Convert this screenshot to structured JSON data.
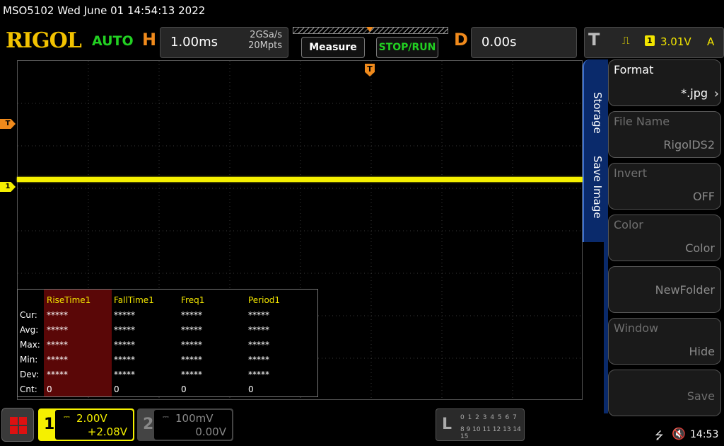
{
  "status_line": "MSO5102  Wed June 01 14:54:13 2022",
  "brand": "RIGOL",
  "trigger_mode": "AUTO",
  "horizontal": {
    "letter": "H",
    "timebase": "1.00ms",
    "sample_rate": "2GSa/s",
    "memory_depth": "20Mpts"
  },
  "toolbar": {
    "measure_label": "Measure",
    "stoprun_label": "STOP/RUN"
  },
  "delay": {
    "letter": "D",
    "value": "0.00s"
  },
  "trigger": {
    "letter": "T",
    "source": "1",
    "level": "3.01V",
    "coupling": "A",
    "edge_icon": "rising-edge-icon"
  },
  "markers": {
    "trigger_level": "T",
    "ch1_offset": "1",
    "trigger_position": "T"
  },
  "measurements": {
    "headers": [
      "RiseTime1",
      "FallTime1",
      "Freq1",
      "Period1"
    ],
    "rows": [
      {
        "label": "Cur:",
        "values": [
          "*****",
          "*****",
          "*****",
          "*****"
        ]
      },
      {
        "label": "Avg:",
        "values": [
          "*****",
          "*****",
          "*****",
          "*****"
        ]
      },
      {
        "label": "Max:",
        "values": [
          "*****",
          "*****",
          "*****",
          "*****"
        ]
      },
      {
        "label": "Min:",
        "values": [
          "*****",
          "*****",
          "*****",
          "*****"
        ]
      },
      {
        "label": "Dev:",
        "values": [
          "*****",
          "*****",
          "*****",
          "*****"
        ]
      },
      {
        "label": "Cnt:",
        "values": [
          "0",
          "0",
          "0",
          "0"
        ]
      }
    ]
  },
  "side_tabs": {
    "storage": "Storage",
    "save_image": "Save Image"
  },
  "menu": {
    "format": {
      "label": "Format",
      "value": "*.jpg"
    },
    "file_name": {
      "label": "File Name",
      "value": "RigolDS2"
    },
    "invert": {
      "label": "Invert",
      "value": "OFF"
    },
    "color": {
      "label": "Color",
      "value": "Color"
    },
    "new_folder": {
      "value": "NewFolder"
    },
    "window": {
      "label": "Window",
      "value": "Hide"
    },
    "save": {
      "value": "Save"
    }
  },
  "ch1": {
    "number": "1",
    "coupling": "⎓",
    "scale": "2.00V",
    "offset": "+2.08V"
  },
  "ch2": {
    "number": "2",
    "coupling": "⎓",
    "scale": "100mV",
    "offset": "0.00V"
  },
  "logic": {
    "letter": "L",
    "row1": "0 1 2 3  4 5 6 7",
    "row2": "8 9 10 11 12 13 14 15"
  },
  "tray": {
    "usb": "⭍",
    "speaker": "🔇",
    "clock": "14:53"
  },
  "colors": {
    "ch1": "#f5f000",
    "trigger": "#f08a1c",
    "accent_green": "#22d022",
    "menu_tab": "#0a2a6b"
  }
}
